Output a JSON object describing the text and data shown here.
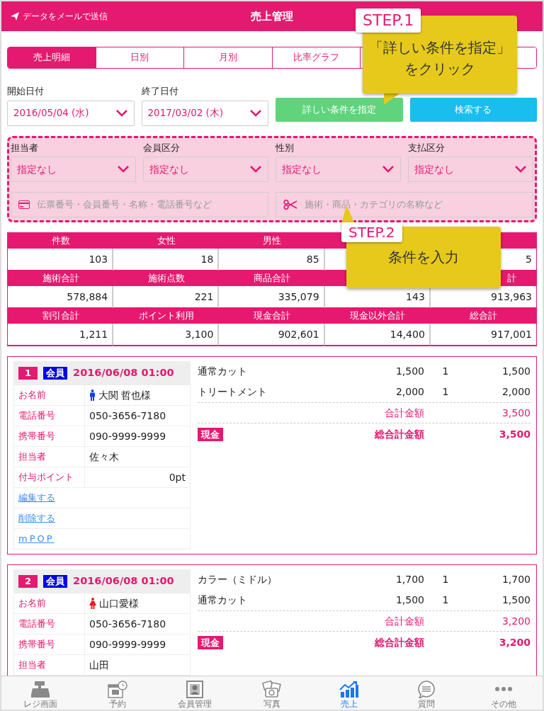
{
  "header": {
    "action": "データをメールで送信",
    "title": "売上管理"
  },
  "tabs": [
    {
      "label": "売上明細",
      "selected": true
    },
    {
      "label": "日別",
      "selected": false
    },
    {
      "label": "月別",
      "selected": false
    },
    {
      "label": "比率グラフ",
      "selected": false
    },
    {
      "selected": false
    }
  ],
  "dates": [
    {
      "label": "開始日付",
      "value": "2016/05/04 (水)"
    },
    {
      "label": "終了日付",
      "value": "2017/03/02 (木)"
    }
  ],
  "buttons": [
    {
      "kind": "detail",
      "label": "詳しい条件を指定"
    },
    {
      "kind": "search",
      "label": "検索する"
    }
  ],
  "filters": {
    "selects": [
      {
        "label": "担当者",
        "value": "指定なし"
      },
      {
        "label": "会員区分",
        "value": "指定なし"
      },
      {
        "label": "性別",
        "value": "指定なし"
      },
      {
        "label": "支払区分",
        "value": "指定なし"
      }
    ],
    "fields": [
      {
        "kind": "card",
        "placeholder": "伝票番号・会員番号・名称・電話番号など"
      },
      {
        "kind": "scissors",
        "placeholder": "施術・商品・カテゴリの名称など"
      }
    ]
  },
  "summary": [
    [
      {
        "header": "件数",
        "value": "103"
      },
      {
        "header": "女性",
        "value": "18"
      },
      {
        "header": "男性",
        "value": "85"
      },
      {
        "value": "5"
      }
    ],
    [
      {
        "header": "施術合計",
        "value": "578,884"
      },
      {
        "header": "施術点数",
        "value": "221"
      },
      {
        "header": "商品合計",
        "value": "335,079"
      },
      {
        "value": "143"
      },
      {
        "header": "計",
        "value": "913,963"
      }
    ],
    [
      {
        "header": "割引合計",
        "value": "1,211"
      },
      {
        "header": "ポイント利用",
        "value": "3,100"
      },
      {
        "header": "現金合計",
        "value": "902,601"
      },
      {
        "header": "現金以外合計",
        "value": "14,400"
      },
      {
        "header": "総合計",
        "value": "917,001"
      }
    ]
  ],
  "records": [
    {
      "number": "1",
      "member_badge": "会員",
      "datetime": "2016/06/08 01:00",
      "fields": [
        {
          "label": "お名前",
          "value": "大関 哲也様",
          "kind": "male"
        },
        {
          "label": "電話番号",
          "value": "050-3656-7180"
        },
        {
          "label": "携帯番号",
          "value": "090-9999-9999"
        },
        {
          "label": "担当者",
          "value": "佐々木"
        },
        {
          "label": "付与ポイント",
          "value": "0pt",
          "kind": "points"
        }
      ],
      "links": [
        "編集する",
        "削除する",
        "mPOP"
      ],
      "items": [
        {
          "name": "通常カット",
          "price": "1,500",
          "qty": "1",
          "amount": "1,500"
        },
        {
          "name": "トリートメント",
          "price": "2,000",
          "qty": "1",
          "amount": "2,000"
        }
      ],
      "subtotal_label": "合計金額",
      "subtotal": "3,500",
      "payment": "現金",
      "total_label": "総合計金額",
      "total": "3,500"
    },
    {
      "number": "2",
      "member_badge": "会員",
      "datetime": "2016/06/08 01:00",
      "fields": [
        {
          "label": "お名前",
          "value": "山口愛様",
          "kind": "female"
        },
        {
          "label": "電話番号",
          "value": "050-3656-7180"
        },
        {
          "label": "携帯番号",
          "value": "090-9999-9999"
        },
        {
          "label": "担当者",
          "value": "山田"
        }
      ],
      "items": [
        {
          "name": "カラー（ミドル）",
          "price": "1,700",
          "qty": "1",
          "amount": "1,700"
        },
        {
          "name": "通常カット",
          "price": "1,500",
          "qty": "1",
          "amount": "1,500"
        }
      ],
      "subtotal_label": "合計金額",
      "subtotal": "3,200",
      "payment": "現金",
      "total_label": "総合計金額",
      "total": "3,200"
    }
  ],
  "tabbar": [
    {
      "label": "レジ画面",
      "selected": false
    },
    {
      "label": "予約",
      "selected": false
    },
    {
      "label": "会員管理",
      "selected": false
    },
    {
      "label": "写真",
      "selected": false
    },
    {
      "label": "売上",
      "selected": true
    },
    {
      "label": "質問",
      "selected": false
    },
    {
      "label": "その他",
      "selected": false
    }
  ],
  "callouts": [
    {
      "step": "STEP.1",
      "lines": [
        "「詳しい条件を指定」",
        "をクリック"
      ]
    },
    {
      "step": "STEP.2",
      "lines": [
        "条件を入力"
      ]
    }
  ]
}
